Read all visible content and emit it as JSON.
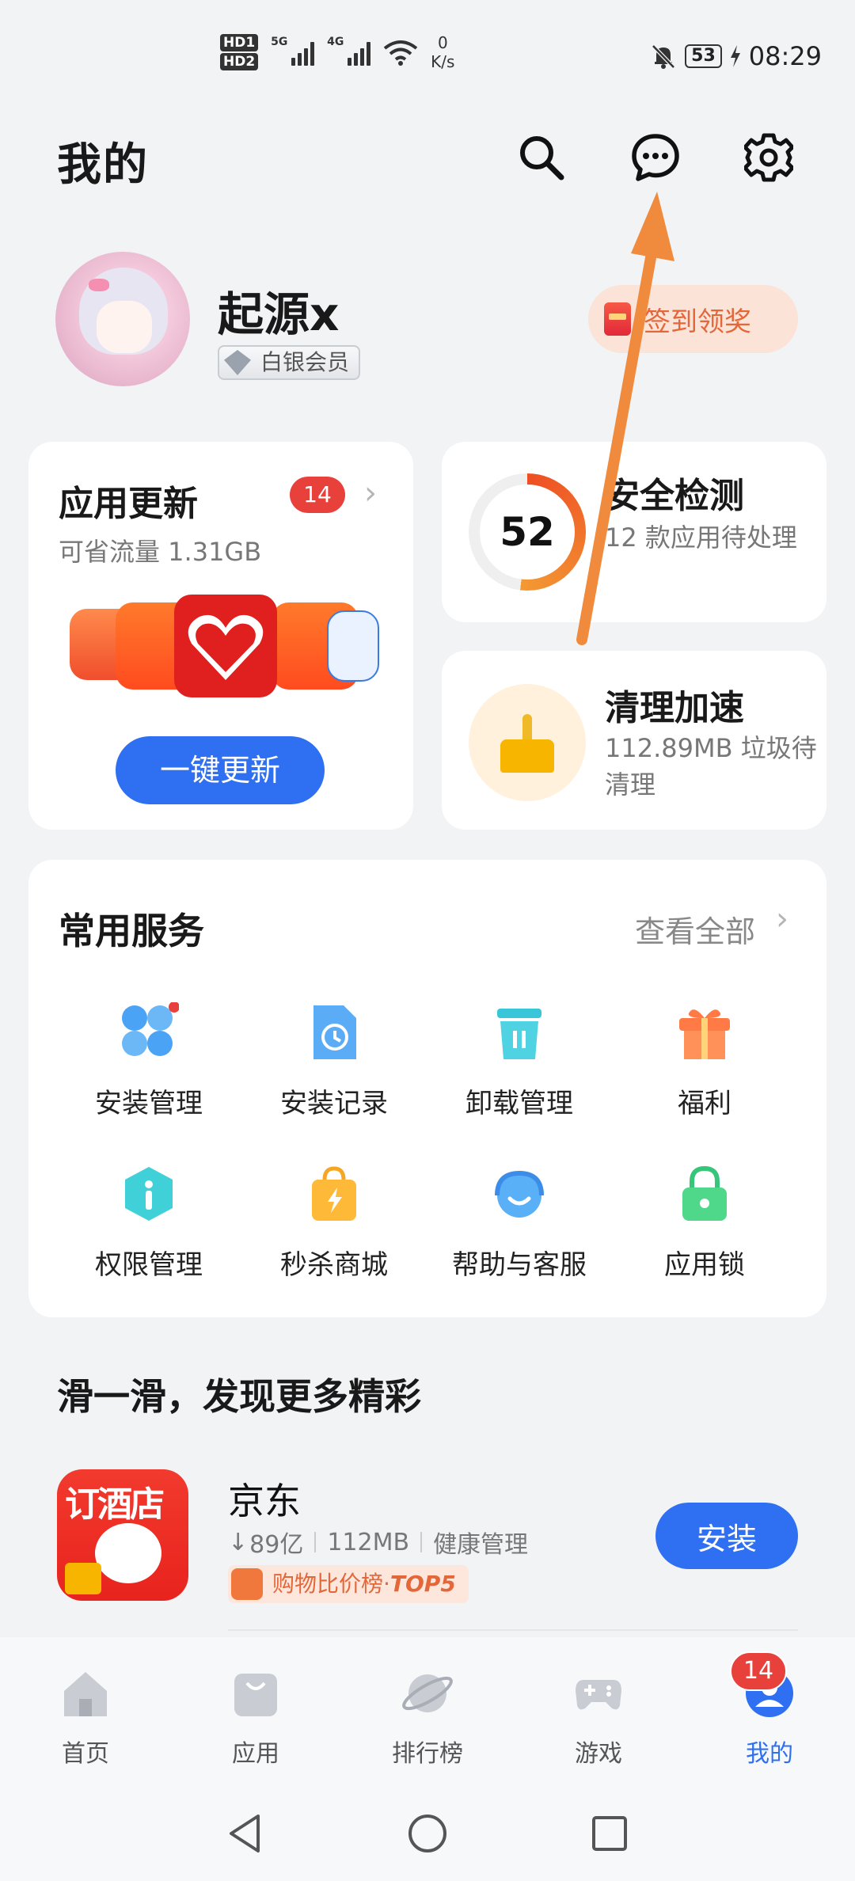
{
  "status_bar": {
    "hd1": "HD1",
    "hd2": "HD2",
    "sig1_label": "5G",
    "sig2_label": "4G",
    "speed_value": "0",
    "speed_unit": "K/s",
    "battery": "53",
    "time": "08:29"
  },
  "header": {
    "title": "我的",
    "icons": [
      "search-icon",
      "message-icon",
      "settings-icon"
    ]
  },
  "profile": {
    "username": "起源x",
    "member_level": "白银会员",
    "signin_label": "签到领奖"
  },
  "app_update": {
    "title": "应用更新",
    "badge": "14",
    "subtitle": "可省流量 1.31GB",
    "button": "一键更新"
  },
  "security": {
    "score": "52",
    "title": "安全检测",
    "desc": "12 款应用待处理"
  },
  "cleanup": {
    "title": "清理加速",
    "desc": "112.89MB 垃圾待清理"
  },
  "services": {
    "title": "常用服务",
    "view_all": "查看全部",
    "items": [
      {
        "label": "安装管理",
        "icon": "install-manage-icon"
      },
      {
        "label": "安装记录",
        "icon": "install-history-icon"
      },
      {
        "label": "卸载管理",
        "icon": "uninstall-icon"
      },
      {
        "label": "福利",
        "icon": "gift-icon"
      },
      {
        "label": "权限管理",
        "icon": "permission-icon"
      },
      {
        "label": "秒杀商城",
        "icon": "flash-sale-icon"
      },
      {
        "label": "帮助与客服",
        "icon": "support-icon"
      },
      {
        "label": "应用锁",
        "icon": "app-lock-icon"
      }
    ]
  },
  "discover": {
    "title": "滑一滑，发现更多精彩",
    "app": {
      "icon_text": "订酒店",
      "name": "京东",
      "downloads": "89亿",
      "size": "112MB",
      "category": "健康管理",
      "rank_prefix": "购物比价榜·",
      "rank_top": "TOP5",
      "install": "安装"
    }
  },
  "bottom_nav": {
    "items": [
      {
        "label": "首页",
        "icon": "home-icon"
      },
      {
        "label": "应用",
        "icon": "apps-icon"
      },
      {
        "label": "排行榜",
        "icon": "ranking-icon"
      },
      {
        "label": "游戏",
        "icon": "game-icon"
      },
      {
        "label": "我的",
        "icon": "profile-icon"
      }
    ],
    "badge": "14",
    "active": "我的"
  },
  "colors": {
    "accent": "#2f6ff2",
    "badge_red": "#e8413c",
    "annotation_arrow": "#f08a3c"
  }
}
